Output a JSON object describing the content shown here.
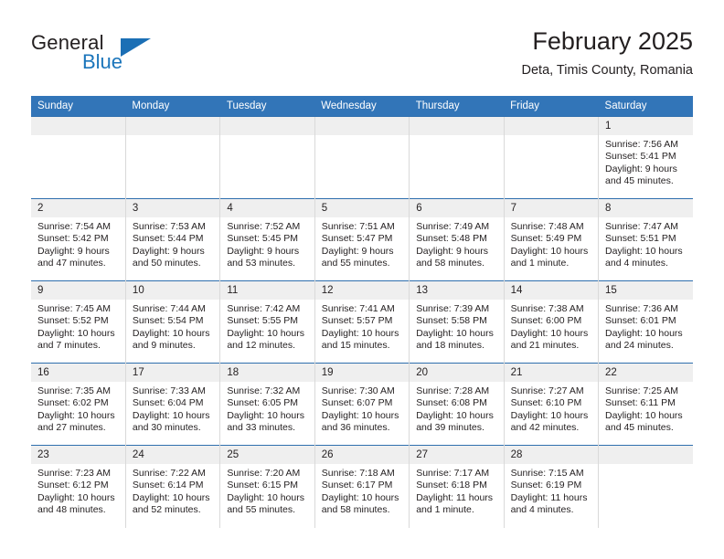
{
  "brand": {
    "name_part1": "General",
    "name_part2": "Blue",
    "logo_icon": "triangle-flag-icon",
    "accent_color": "#1b75bb"
  },
  "header": {
    "title": "February 2025",
    "subtitle": "Deta, Timis County, Romania"
  },
  "theme": {
    "header_row_bg": "#3275b8",
    "row_divider": "#2f6fae",
    "daynum_band_bg": "#efefef",
    "text_color": "#231f20"
  },
  "calendar": {
    "weekday_headers": [
      "Sunday",
      "Monday",
      "Tuesday",
      "Wednesday",
      "Thursday",
      "Friday",
      "Saturday"
    ],
    "labels": {
      "sunrise": "Sunrise:",
      "sunset": "Sunset:",
      "daylight": "Daylight:"
    },
    "weeks": [
      [
        {
          "day": "",
          "blank": true
        },
        {
          "day": "",
          "blank": true
        },
        {
          "day": "",
          "blank": true
        },
        {
          "day": "",
          "blank": true
        },
        {
          "day": "",
          "blank": true
        },
        {
          "day": "",
          "blank": true
        },
        {
          "day": "1",
          "sunrise": "Sunrise: 7:56 AM",
          "sunset": "Sunset: 5:41 PM",
          "daylight_1": "Daylight: 9 hours",
          "daylight_2": "and 45 minutes."
        }
      ],
      [
        {
          "day": "2",
          "sunrise": "Sunrise: 7:54 AM",
          "sunset": "Sunset: 5:42 PM",
          "daylight_1": "Daylight: 9 hours",
          "daylight_2": "and 47 minutes."
        },
        {
          "day": "3",
          "sunrise": "Sunrise: 7:53 AM",
          "sunset": "Sunset: 5:44 PM",
          "daylight_1": "Daylight: 9 hours",
          "daylight_2": "and 50 minutes."
        },
        {
          "day": "4",
          "sunrise": "Sunrise: 7:52 AM",
          "sunset": "Sunset: 5:45 PM",
          "daylight_1": "Daylight: 9 hours",
          "daylight_2": "and 53 minutes."
        },
        {
          "day": "5",
          "sunrise": "Sunrise: 7:51 AM",
          "sunset": "Sunset: 5:47 PM",
          "daylight_1": "Daylight: 9 hours",
          "daylight_2": "and 55 minutes."
        },
        {
          "day": "6",
          "sunrise": "Sunrise: 7:49 AM",
          "sunset": "Sunset: 5:48 PM",
          "daylight_1": "Daylight: 9 hours",
          "daylight_2": "and 58 minutes."
        },
        {
          "day": "7",
          "sunrise": "Sunrise: 7:48 AM",
          "sunset": "Sunset: 5:49 PM",
          "daylight_1": "Daylight: 10 hours",
          "daylight_2": "and 1 minute."
        },
        {
          "day": "8",
          "sunrise": "Sunrise: 7:47 AM",
          "sunset": "Sunset: 5:51 PM",
          "daylight_1": "Daylight: 10 hours",
          "daylight_2": "and 4 minutes."
        }
      ],
      [
        {
          "day": "9",
          "sunrise": "Sunrise: 7:45 AM",
          "sunset": "Sunset: 5:52 PM",
          "daylight_1": "Daylight: 10 hours",
          "daylight_2": "and 7 minutes."
        },
        {
          "day": "10",
          "sunrise": "Sunrise: 7:44 AM",
          "sunset": "Sunset: 5:54 PM",
          "daylight_1": "Daylight: 10 hours",
          "daylight_2": "and 9 minutes."
        },
        {
          "day": "11",
          "sunrise": "Sunrise: 7:42 AM",
          "sunset": "Sunset: 5:55 PM",
          "daylight_1": "Daylight: 10 hours",
          "daylight_2": "and 12 minutes."
        },
        {
          "day": "12",
          "sunrise": "Sunrise: 7:41 AM",
          "sunset": "Sunset: 5:57 PM",
          "daylight_1": "Daylight: 10 hours",
          "daylight_2": "and 15 minutes."
        },
        {
          "day": "13",
          "sunrise": "Sunrise: 7:39 AM",
          "sunset": "Sunset: 5:58 PM",
          "daylight_1": "Daylight: 10 hours",
          "daylight_2": "and 18 minutes."
        },
        {
          "day": "14",
          "sunrise": "Sunrise: 7:38 AM",
          "sunset": "Sunset: 6:00 PM",
          "daylight_1": "Daylight: 10 hours",
          "daylight_2": "and 21 minutes."
        },
        {
          "day": "15",
          "sunrise": "Sunrise: 7:36 AM",
          "sunset": "Sunset: 6:01 PM",
          "daylight_1": "Daylight: 10 hours",
          "daylight_2": "and 24 minutes."
        }
      ],
      [
        {
          "day": "16",
          "sunrise": "Sunrise: 7:35 AM",
          "sunset": "Sunset: 6:02 PM",
          "daylight_1": "Daylight: 10 hours",
          "daylight_2": "and 27 minutes."
        },
        {
          "day": "17",
          "sunrise": "Sunrise: 7:33 AM",
          "sunset": "Sunset: 6:04 PM",
          "daylight_1": "Daylight: 10 hours",
          "daylight_2": "and 30 minutes."
        },
        {
          "day": "18",
          "sunrise": "Sunrise: 7:32 AM",
          "sunset": "Sunset: 6:05 PM",
          "daylight_1": "Daylight: 10 hours",
          "daylight_2": "and 33 minutes."
        },
        {
          "day": "19",
          "sunrise": "Sunrise: 7:30 AM",
          "sunset": "Sunset: 6:07 PM",
          "daylight_1": "Daylight: 10 hours",
          "daylight_2": "and 36 minutes."
        },
        {
          "day": "20",
          "sunrise": "Sunrise: 7:28 AM",
          "sunset": "Sunset: 6:08 PM",
          "daylight_1": "Daylight: 10 hours",
          "daylight_2": "and 39 minutes."
        },
        {
          "day": "21",
          "sunrise": "Sunrise: 7:27 AM",
          "sunset": "Sunset: 6:10 PM",
          "daylight_1": "Daylight: 10 hours",
          "daylight_2": "and 42 minutes."
        },
        {
          "day": "22",
          "sunrise": "Sunrise: 7:25 AM",
          "sunset": "Sunset: 6:11 PM",
          "daylight_1": "Daylight: 10 hours",
          "daylight_2": "and 45 minutes."
        }
      ],
      [
        {
          "day": "23",
          "sunrise": "Sunrise: 7:23 AM",
          "sunset": "Sunset: 6:12 PM",
          "daylight_1": "Daylight: 10 hours",
          "daylight_2": "and 48 minutes."
        },
        {
          "day": "24",
          "sunrise": "Sunrise: 7:22 AM",
          "sunset": "Sunset: 6:14 PM",
          "daylight_1": "Daylight: 10 hours",
          "daylight_2": "and 52 minutes."
        },
        {
          "day": "25",
          "sunrise": "Sunrise: 7:20 AM",
          "sunset": "Sunset: 6:15 PM",
          "daylight_1": "Daylight: 10 hours",
          "daylight_2": "and 55 minutes."
        },
        {
          "day": "26",
          "sunrise": "Sunrise: 7:18 AM",
          "sunset": "Sunset: 6:17 PM",
          "daylight_1": "Daylight: 10 hours",
          "daylight_2": "and 58 minutes."
        },
        {
          "day": "27",
          "sunrise": "Sunrise: 7:17 AM",
          "sunset": "Sunset: 6:18 PM",
          "daylight_1": "Daylight: 11 hours",
          "daylight_2": "and 1 minute."
        },
        {
          "day": "28",
          "sunrise": "Sunrise: 7:15 AM",
          "sunset": "Sunset: 6:19 PM",
          "daylight_1": "Daylight: 11 hours",
          "daylight_2": "and 4 minutes."
        },
        {
          "day": "",
          "blank": true
        }
      ]
    ]
  }
}
